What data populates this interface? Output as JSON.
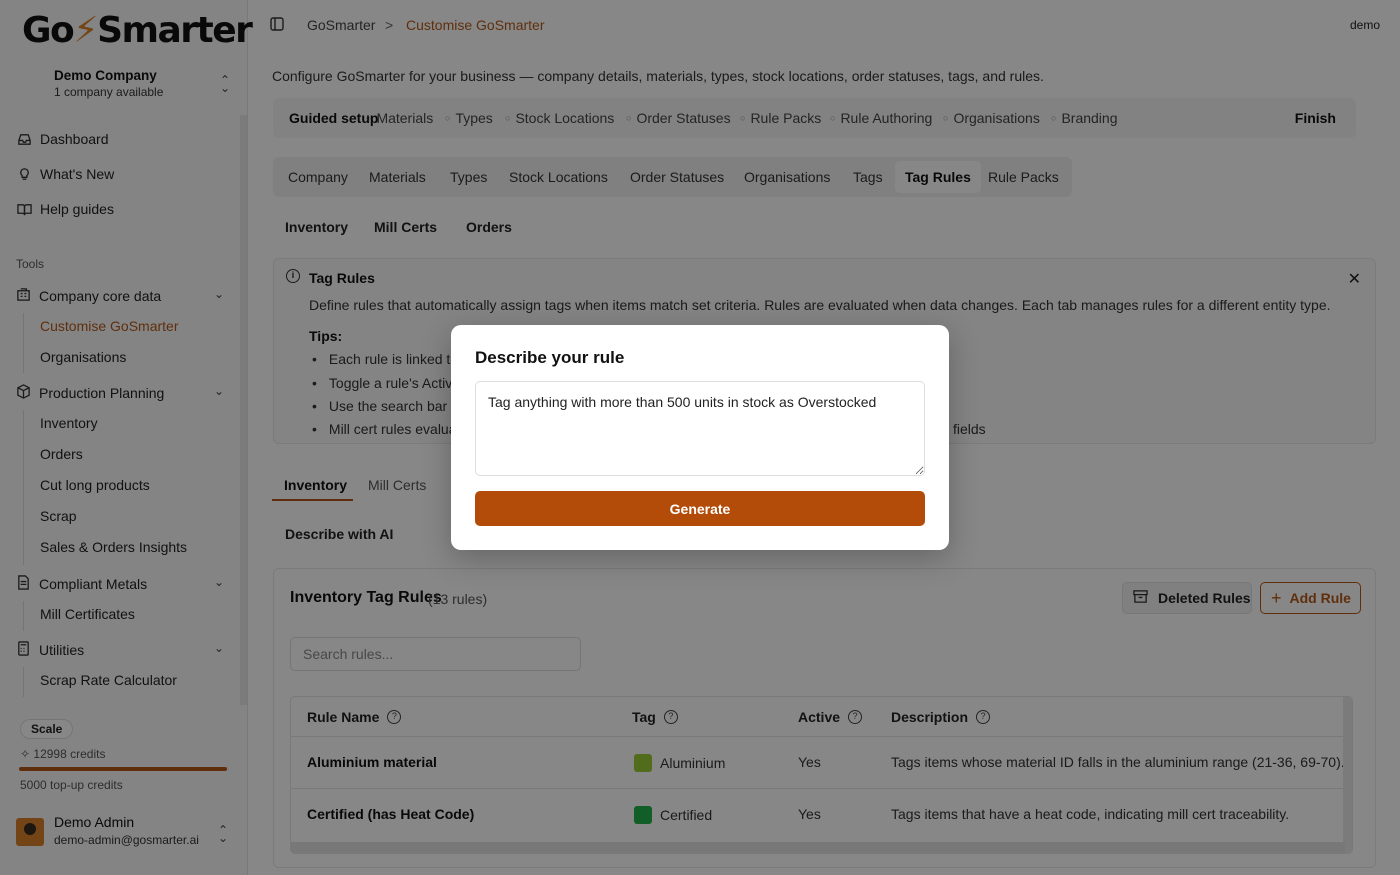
{
  "app": {
    "logo_pre": "Go",
    "logo_bolt": "⚡",
    "logo_post": "Smarter"
  },
  "sidebar": {
    "company_name": "Demo Company",
    "company_sub": "1 company available",
    "nav": [
      {
        "label": "Dashboard",
        "icon": "inbox-icon"
      },
      {
        "label": "What's New",
        "icon": "lightbulb-icon"
      },
      {
        "label": "Help guides",
        "icon": "book-icon"
      }
    ],
    "tools_label": "Tools",
    "groups": [
      {
        "label": "Company core data",
        "icon": "building-icon",
        "items": [
          "Customise GoSmarter",
          "Organisations"
        ]
      },
      {
        "label": "Production Planning",
        "icon": "package-icon",
        "items": [
          "Inventory",
          "Orders",
          "Cut long products",
          "Scrap",
          "Sales & Orders Insights"
        ]
      },
      {
        "label": "Compliant Metals",
        "icon": "document-icon",
        "items": [
          "Mill Certificates"
        ]
      },
      {
        "label": "Utilities",
        "icon": "calculator-icon",
        "items": [
          "Scrap Rate Calculator"
        ]
      }
    ],
    "plan": "Scale",
    "credits": "12998 credits",
    "credit_fraction": 0.99,
    "topup": "5000 top-up credits",
    "user_name": "Demo Admin",
    "user_email": "demo-admin@gosmarter.ai"
  },
  "header": {
    "crumb_root": "GoSmarter",
    "crumb_sep": ">",
    "crumb_current": "Customise GoSmarter",
    "user": "demo"
  },
  "main": {
    "intro": "Configure GoSmarter for your business — company details, materials, types, stock locations, order statuses, tags, and rules.",
    "guided": {
      "title": "Guided setup",
      "steps": [
        "Materials",
        "Types",
        "Stock Locations",
        "Order Statuses",
        "Rule Packs",
        "Rule Authoring",
        "Organisations",
        "Branding"
      ],
      "finish": "Finish"
    },
    "tabs": [
      "Company",
      "Materials",
      "Types",
      "Stock Locations",
      "Order Statuses",
      "Organisations",
      "Tags",
      "Tag Rules",
      "Rule Packs"
    ],
    "subtabs": [
      "Inventory",
      "Mill Certs",
      "Orders"
    ],
    "info": {
      "title": "Tag Rules",
      "description": "Define rules that automatically assign tags when items match set criteria. Rules are evaluated when data changes. Each tab manages rules for a different entity type.",
      "tips_title": "Tips:",
      "tips": [
        "Each rule is linked to",
        "Toggle a rule's Active",
        "Use the search bar to",
        "Mill cert rules evalua"
      ],
      "tip_tail": "fields"
    },
    "tabs2": [
      "Inventory",
      "Mill Certs"
    ],
    "describe_ai": "Describe with AI",
    "rules": {
      "title": "Inventory Tag Rules",
      "count": "(13 rules)",
      "deleted_label": "Deleted Rules",
      "add_label": "Add Rule",
      "search_placeholder": "Search rules...",
      "columns": [
        "Rule Name",
        "Tag",
        "Active",
        "Description"
      ],
      "rows": [
        {
          "name": "Aluminium material",
          "tag": "Aluminium",
          "tag_color": "#9acd32",
          "active": "Yes",
          "description": "Tags items whose material ID falls in the aluminium range (21-36, 69-70)."
        },
        {
          "name": "Certified (has Heat Code)",
          "tag": "Certified",
          "tag_color": "#22b14c",
          "active": "Yes",
          "description": "Tags items that have a heat code, indicating mill cert traceability."
        }
      ]
    }
  },
  "modal": {
    "title": "Describe your rule",
    "text": "Tag anything with more than 500 units in stock as Overstocked",
    "button": "Generate"
  },
  "colors": {
    "accent": "#b45a1a",
    "button": "#b24c08"
  }
}
